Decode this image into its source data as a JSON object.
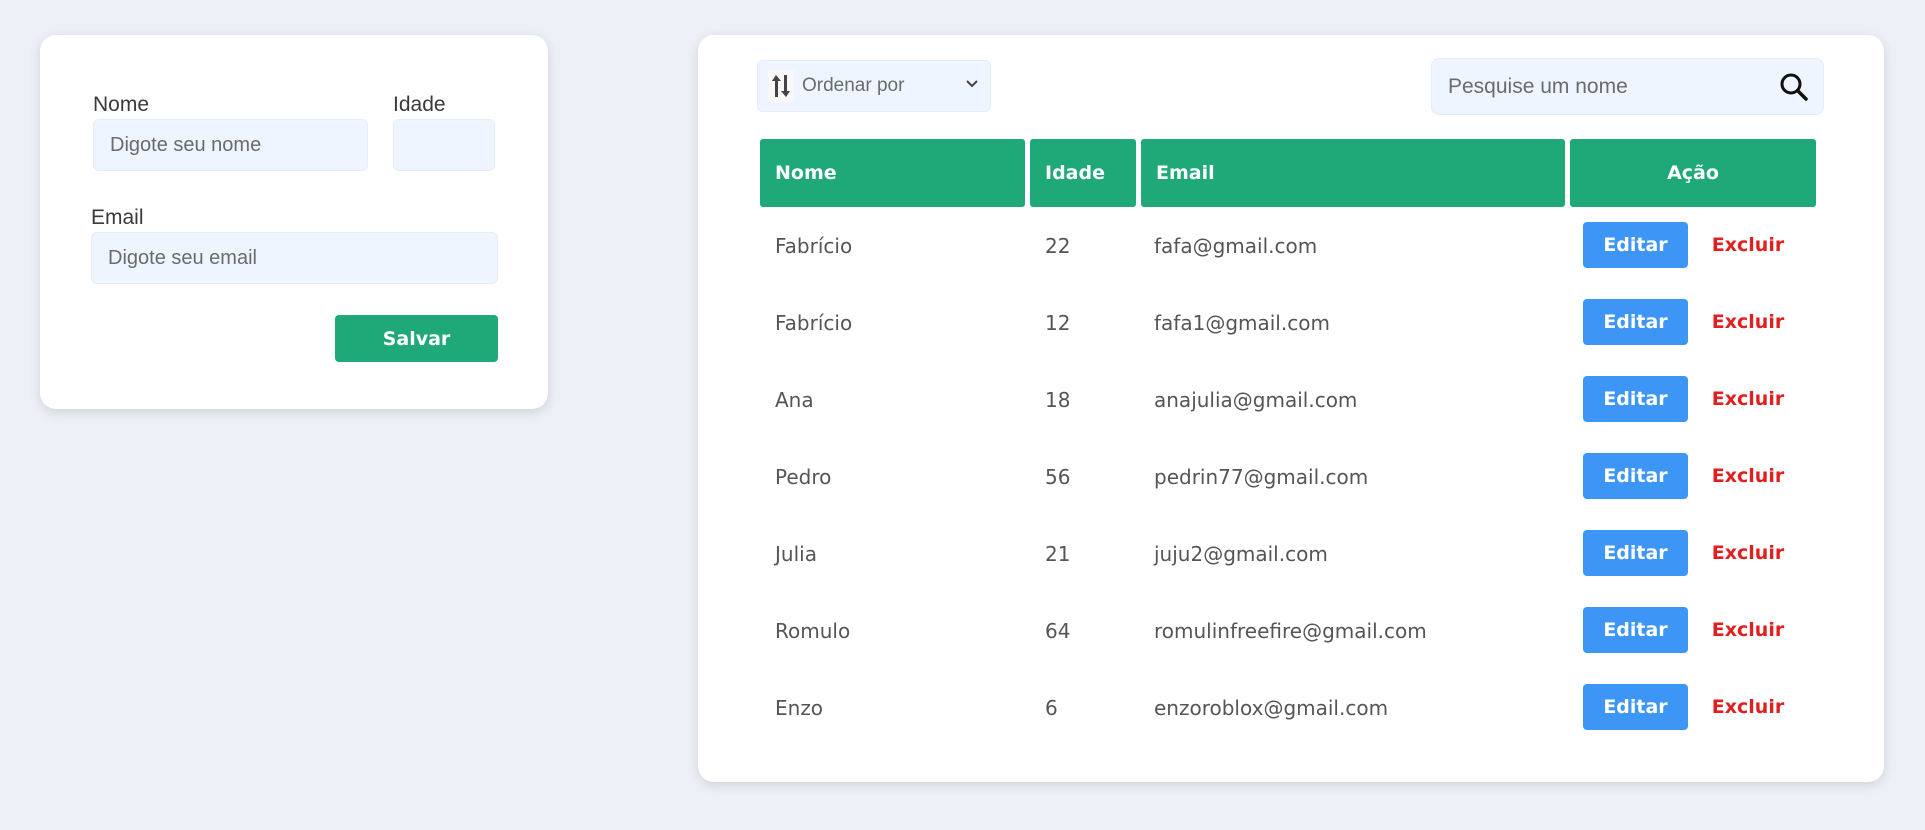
{
  "form": {
    "name_label": "Nome",
    "name_placeholder": "Digote seu nome",
    "age_label": "Idade",
    "age_placeholder": "",
    "email_label": "Email",
    "email_placeholder": "Digote seu email",
    "save_label": "Salvar"
  },
  "toolbar": {
    "sort_label": "Ordenar por",
    "sort_icon": "sort-arrows-icon",
    "chevron_icon": "chevron-down-icon",
    "search_placeholder": "Pesquise um nome",
    "search_icon": "search-icon"
  },
  "table": {
    "headers": [
      "Nome",
      "Idade",
      "Email",
      "Ação"
    ],
    "rows": [
      {
        "name": "Fabrício",
        "age": "22",
        "email": "fafa@gmail.com",
        "edit": "Editar",
        "delete": "Excluir"
      },
      {
        "name": "Fabrício",
        "age": "12",
        "email": "fafa1@gmail.com",
        "edit": "Editar",
        "delete": "Excluir"
      },
      {
        "name": "Ana",
        "age": "18",
        "email": "anajulia@gmail.com",
        "edit": "Editar",
        "delete": "Excluir"
      },
      {
        "name": "Pedro",
        "age": "56",
        "email": "pedrin77@gmail.com",
        "edit": "Editar",
        "delete": "Excluir"
      },
      {
        "name": "Julia",
        "age": "21",
        "email": "juju2@gmail.com",
        "edit": "Editar",
        "delete": "Excluir"
      },
      {
        "name": "Romulo",
        "age": "64",
        "email": "romulinfreefire@gmail.com",
        "edit": "Editar",
        "delete": "Excluir"
      },
      {
        "name": "Enzo",
        "age": "6",
        "email": "enzoroblox@gmail.com",
        "edit": "Editar",
        "delete": "Excluir"
      }
    ]
  },
  "colors": {
    "background": "#eef0f8",
    "primary_green": "#1fa878",
    "edit_blue": "#3d96f5",
    "delete_red": "#e02020",
    "input_bg": "#eff5ff"
  }
}
